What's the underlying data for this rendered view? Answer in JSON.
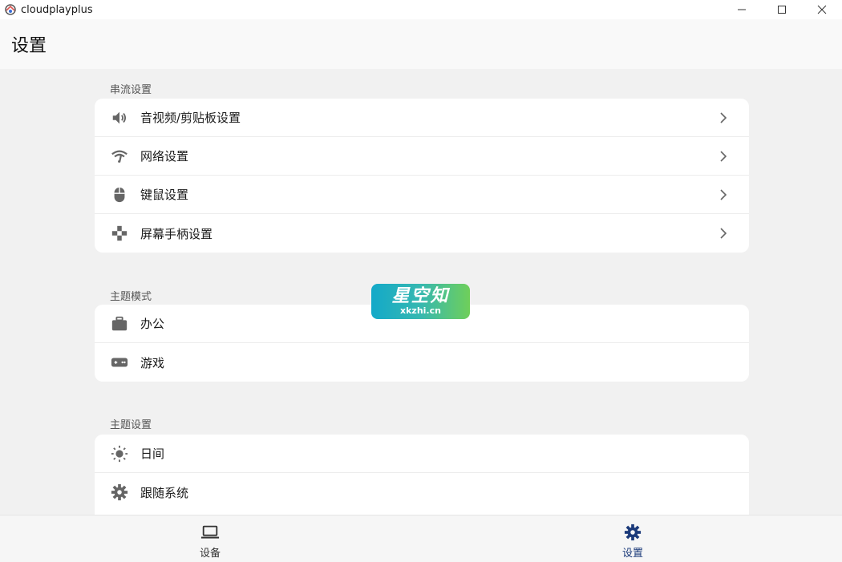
{
  "window": {
    "title": "cloudplayplus"
  },
  "page": {
    "title": "设置"
  },
  "sections": [
    {
      "label": "串流设置",
      "items": [
        {
          "label": "音视频/剪贴板设置",
          "icon": "volume-icon"
        },
        {
          "label": "网络设置",
          "icon": "wifi-icon"
        },
        {
          "label": "键鼠设置",
          "icon": "mouse-icon"
        },
        {
          "label": "屏幕手柄设置",
          "icon": "gamepad-icon"
        }
      ]
    },
    {
      "label": "主题模式",
      "items": [
        {
          "label": "办公",
          "icon": "briefcase-icon"
        },
        {
          "label": "游戏",
          "icon": "game-controller-icon"
        }
      ]
    },
    {
      "label": "主题设置",
      "items": [
        {
          "label": "日间",
          "icon": "sun-icon"
        },
        {
          "label": "跟随系统",
          "icon": "gear-icon"
        }
      ]
    }
  ],
  "watermark": {
    "main": "星空知",
    "sub": "xkzhi.cn"
  },
  "bottom_nav": {
    "items": [
      {
        "label": "设备",
        "icon": "laptop-icon"
      },
      {
        "label": "设置",
        "icon": "gear-icon"
      }
    ],
    "active_color": "#1b3a7a"
  }
}
